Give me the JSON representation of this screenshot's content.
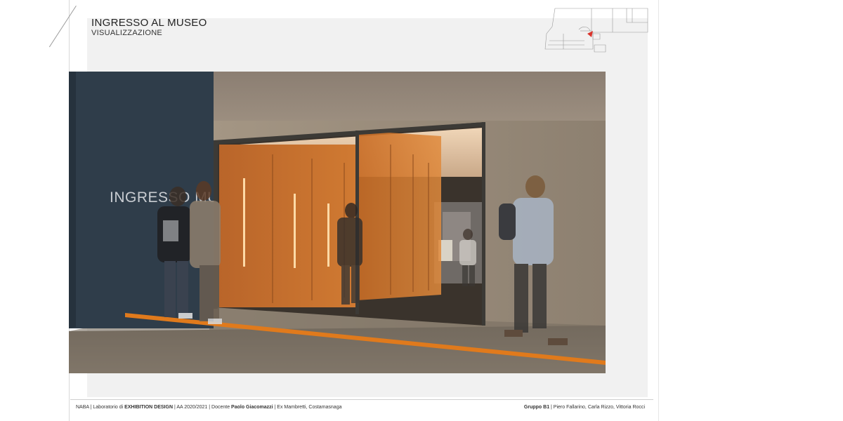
{
  "header": {
    "title": "INGRESSO AL MUSEO",
    "subtitle": "VISUALIZZAZIONE"
  },
  "render": {
    "wall_sign": "INGRESSO MUSEO"
  },
  "footer": {
    "left": {
      "school": "NABA",
      "sep1": " | Laboratorio di ",
      "course": "EXHIBITION DESIGN",
      "sep2": " | AA 2020/2021 | Docente ",
      "teacher": "Paolo Giacomazzi",
      "sep3": " | Ex Mambretti, Costamasnaga"
    },
    "right": {
      "group": "Gruppo B1",
      "members": " | Piero Fallarino, Carla Rizzo, Vittoria Rocci"
    }
  },
  "colors": {
    "wall_blue": "#2f3d4a",
    "orange_panels": "#c96f2a",
    "floor_stripe": "#e07a1c",
    "keyplan_marker": "#d9332b"
  }
}
